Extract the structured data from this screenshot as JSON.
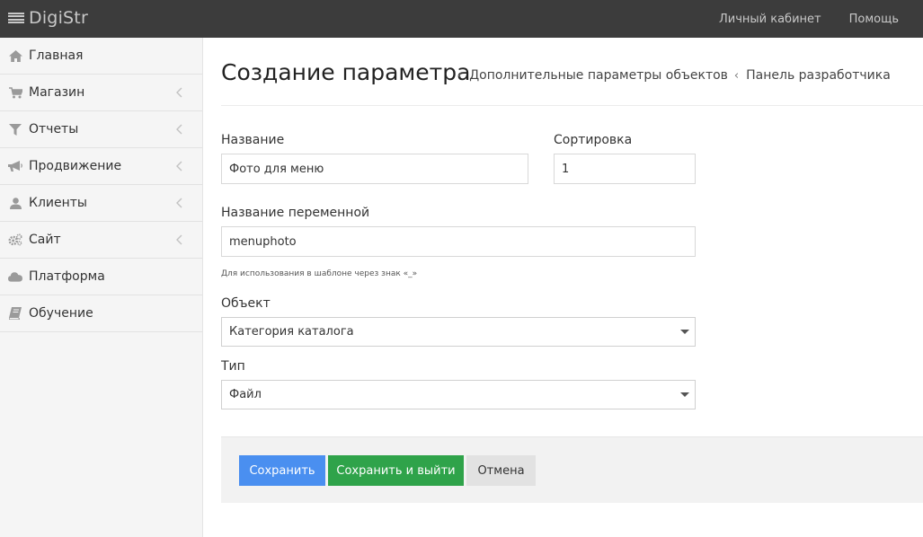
{
  "header": {
    "brand": "DigiStr",
    "nav": [
      {
        "label": "Личный кабинет",
        "name": "nav-personal-account"
      },
      {
        "label": "Помощь",
        "name": "nav-help"
      }
    ]
  },
  "sidebar": {
    "items": [
      {
        "label": "Главная",
        "icon": "home-icon",
        "has_children": false
      },
      {
        "label": "Магазин",
        "icon": "cart-icon",
        "has_children": true
      },
      {
        "label": "Отчеты",
        "icon": "filter-icon",
        "has_children": true
      },
      {
        "label": "Продвижение",
        "icon": "megaphone-icon",
        "has_children": true
      },
      {
        "label": "Клиенты",
        "icon": "user-icon",
        "has_children": true
      },
      {
        "label": "Сайт",
        "icon": "gears-icon",
        "has_children": true
      },
      {
        "label": "Платформа",
        "icon": "cloud-icon",
        "has_children": false
      },
      {
        "label": "Обучение",
        "icon": "book-icon",
        "has_children": false
      }
    ]
  },
  "page": {
    "title": "Создание параметра",
    "breadcrumbs": [
      "Дополнительные параметры объектов",
      "Панель разработчика"
    ]
  },
  "form": {
    "name_label": "Название",
    "name_value": "Фото для меню",
    "sort_label": "Сортировка",
    "sort_value": "1",
    "var_label": "Название переменной",
    "var_value": "menuphoto",
    "var_hint": "Для использования в шаблоне через знак «_»",
    "object_label": "Объект",
    "object_value": "Категория каталога",
    "type_label": "Тип",
    "type_value": "Файл"
  },
  "actions": {
    "save": "Сохранить",
    "save_exit": "Сохранить и выйти",
    "cancel": "Отмена"
  },
  "colors": {
    "topbar": "#3c3c3c",
    "save": "#4a8ff0",
    "save_exit": "#2fa34a",
    "cancel": "#e2e2e2"
  }
}
